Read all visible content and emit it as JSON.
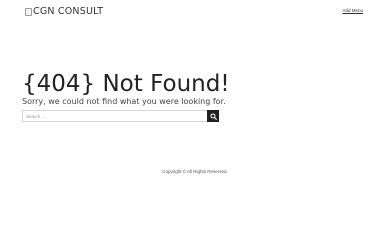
{
  "header": {
    "logo_text": "CGN CONSULT",
    "menu_link": "Add Menu"
  },
  "main": {
    "title": "{404} Not Found!",
    "subtitle": "Sorry, we could not find what you were looking for.",
    "search": {
      "placeholder": "Search ...",
      "value": ""
    }
  },
  "footer": {
    "copyright": "Copyright © All Rights Reserved."
  },
  "icons": {
    "search_button_icon": "search-icon",
    "logo_image": "broken-image-icon"
  }
}
